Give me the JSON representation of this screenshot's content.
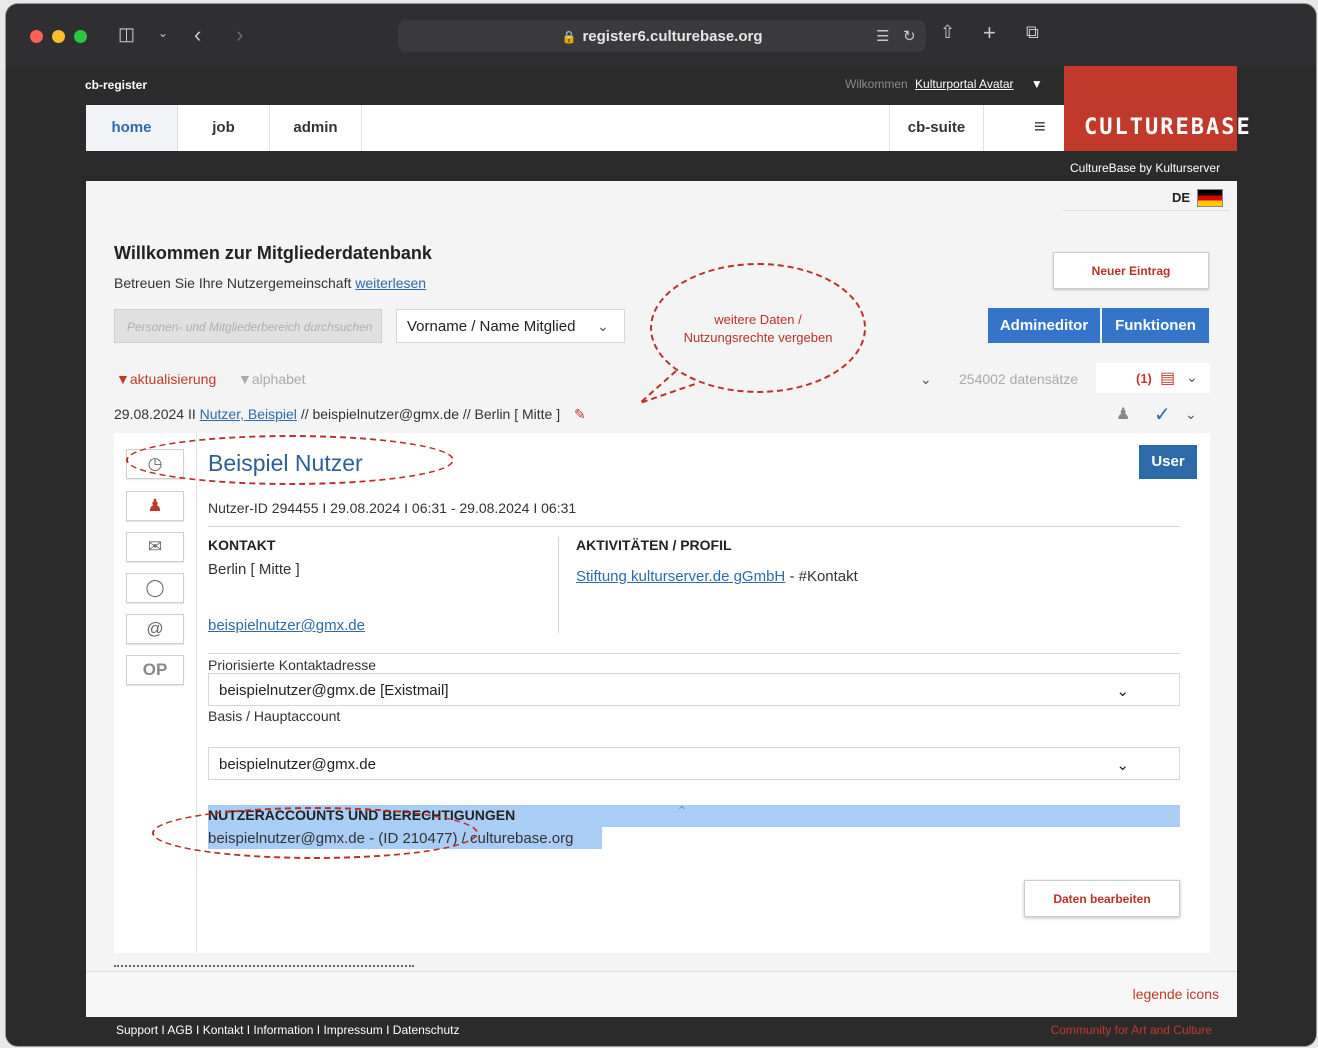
{
  "browser": {
    "url": "register6.culturebase.org"
  },
  "header": {
    "app_name": "cb-register",
    "welcome_label": "Wilkommen",
    "user_link": "Kulturportal Avatar",
    "nav": [
      {
        "label": "home",
        "active": true
      },
      {
        "label": "job",
        "active": false
      },
      {
        "label": "admin",
        "active": false
      }
    ],
    "suite_label": "cb-suite",
    "logo_text": "CULTUREBASE",
    "byline": "CultureBase by Kulturserver",
    "language": "DE"
  },
  "main": {
    "title": "Willkommen zur Mitgliederdatenbank",
    "subtitle": "Betreuen Sie Ihre Nutzergemeinschaft",
    "subtitle_link": "weiterlesen",
    "new_entry_button": "Neuer Eintrag",
    "admineditor_button": "Admineditor",
    "functions_button": "Funktionen",
    "search_placeholder": "Personen- und Mitgliederbereich durchsuchen",
    "search_field_select": "Vorname / Name Mitglied",
    "sort_update": "aktualisierung",
    "sort_alpha": "alphabet",
    "record_count": "254002 datensätze",
    "basket_count": "(1)"
  },
  "record_header": {
    "date": "29.08.2024 II",
    "name_link": "Nutzer, Beispiel",
    "rest": "// beispielnutzer@gmx.de // Berlin [ Mitte ]"
  },
  "record": {
    "title": "Beispiel Nutzer",
    "user_button": "User",
    "meta": "Nutzer-ID 294455 I 29.08.2024 I 06:31 - 29.08.2024 I 06:31",
    "side_op": "OP",
    "contact_title": "KONTAKT",
    "contact_location": "Berlin [ Mitte ]",
    "contact_email": "beispielnutzer@gmx.de",
    "activities_title": "AKTIVITÄTEN / PROFIL",
    "activity_link": "Stiftung kulturserver.de gGmbH",
    "activity_suffix": "- #Kontakt",
    "priority_label": "Priorisierte Kontaktadresse",
    "priority_value": "beispielnutzer@gmx.de [Existmail]",
    "basis_label": "Basis / Hauptaccount",
    "basis_value": "beispielnutzer@gmx.de",
    "accounts_title": "NUTZERACCOUNTS UND BERECHTIGUNGEN",
    "account_entry": "beispielnutzer@gmx.de - (ID 210477) / culturebase.org",
    "edit_button": "Daten bearbeiten"
  },
  "annotation": {
    "callout_line1": "weitere Daten /",
    "callout_line2": "Nutzungsrechte vergeben"
  },
  "footer": {
    "legend_link": "legende icons",
    "links": "Support I AGB I Kontakt I Information I Impressum I Datenschutz",
    "community": "Community for Art and Culture"
  },
  "colors": {
    "accent_red": "#c0392b",
    "link_blue": "#2d6aa8",
    "button_blue": "#3575c9",
    "highlight": "#a9cdf4"
  }
}
